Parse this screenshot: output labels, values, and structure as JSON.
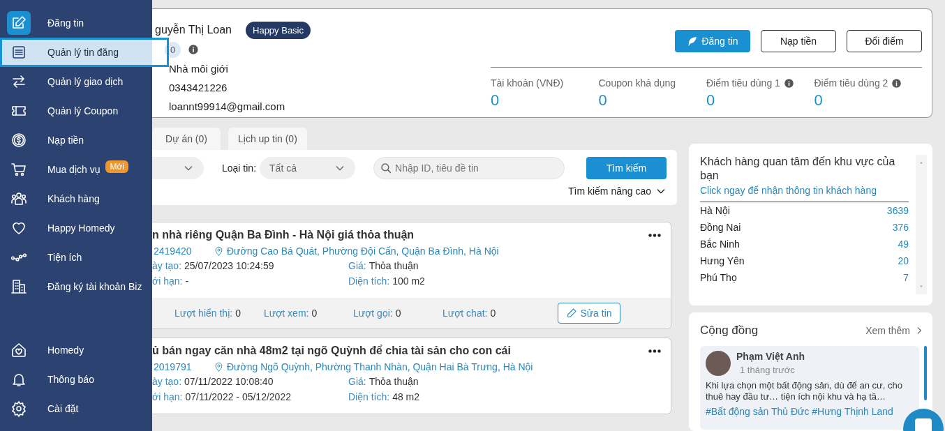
{
  "sidebar": {
    "items": [
      {
        "label": "Đăng tin",
        "selected": false,
        "icon_highlight": true
      },
      {
        "label": "Quản lý tin đăng",
        "selected": true,
        "icon_highlight": false
      },
      {
        "label": "Quản lý giao dịch",
        "selected": false,
        "icon_highlight": false
      },
      {
        "label": "Quản lý Coupon",
        "selected": false,
        "icon_highlight": false
      },
      {
        "label": "Nạp tiền",
        "selected": false,
        "icon_highlight": false
      },
      {
        "label": "Mua dịch vụ",
        "selected": false,
        "icon_highlight": false,
        "badge": "Mới"
      },
      {
        "label": "Khách hàng",
        "selected": false,
        "icon_highlight": false
      },
      {
        "label": "Happy Homedy",
        "selected": false,
        "icon_highlight": false
      },
      {
        "label": "Tiện ích",
        "selected": false,
        "icon_highlight": false
      },
      {
        "label": "Đăng ký tài khoản Biz",
        "selected": false,
        "icon_highlight": false
      }
    ],
    "bottom_items": [
      {
        "label": "Homedy",
        "selected": false
      },
      {
        "label": "Thông báo",
        "selected": false
      },
      {
        "label": "Cài đặt",
        "selected": false
      }
    ]
  },
  "profile": {
    "name": "guyễn Thị Loan",
    "badge": "Happy Basic",
    "points": "0",
    "role": "Nhà môi giới",
    "phone": "0343421226",
    "email": "loannt99914@gmail.com",
    "buttons": [
      {
        "label": "Đăng tin",
        "kind": "primary"
      },
      {
        "label": "Nạp tiền",
        "kind": "outline"
      },
      {
        "label": "Đổi điểm",
        "kind": "outline"
      }
    ],
    "stats": [
      {
        "label": "Tài khoản (VNĐ)",
        "value": "0",
        "info": false
      },
      {
        "label": "Coupon khả dụng",
        "value": "0",
        "info": false
      },
      {
        "label": "Điểm tiêu dùng 1",
        "value": "0",
        "info": true
      },
      {
        "label": "Điểm tiêu dùng 2",
        "value": "0",
        "info": true
      }
    ]
  },
  "tabs": [
    {
      "label": "Dự án (0)"
    },
    {
      "label": "Lịch up tin (0)"
    }
  ],
  "filters": {
    "type_label": "Loại tin:",
    "type_value": "Tất cả",
    "search_placeholder": "Nhập ID, tiêu đề tin",
    "search_button": "Tìm kiếm",
    "advanced": "Tìm kiếm nâng cao"
  },
  "listings": [
    {
      "title": "n nhà riêng Quận Ba Đình - Hà Nội giá thỏa thuận",
      "id": "2419420",
      "address": "Đường Cao Bá Quát, Phường Đội Cấn, Quận Ba Đình, Hà Nội",
      "created_label": "ày tạo:",
      "created": "25/07/2023 10:24:59",
      "limit_label": "ới hạn:",
      "limit": "-",
      "price_label": "Giá:",
      "price": "Thỏa thuận",
      "area_label": "Diện tích:",
      "area": "100 m2",
      "stats": [
        {
          "label": "Lượt hiển thị:",
          "value": "0"
        },
        {
          "label": "Lượt xem:",
          "value": "0"
        },
        {
          "label": "Lượt gọi:",
          "value": "0"
        },
        {
          "label": "Lượt chat:",
          "value": "0"
        }
      ],
      "edit_button": "Sửa tin"
    },
    {
      "title": "ủ bán ngay căn nhà 48m2 tại ngõ Quỳnh để chia tài sản cho con cái",
      "id": "2019791",
      "address": "Đường Ngõ Quỳnh, Phường Thanh Nhàn, Quận Hai Bà Trưng, Hà Nội",
      "created_label": "ày tạo:",
      "created": "07/11/2022 10:08:40",
      "limit_label": "ới hạn:",
      "limit": "07/11/2022 - 05/12/2022",
      "price_label": "Giá:",
      "price": "Thỏa thuận",
      "area_label": "Diện tích:",
      "area": "48 m2"
    }
  ],
  "customer_areas": {
    "title": "Khách hàng quan tâm đến khu vực của bạn",
    "link": "Click ngay để nhận thông tin khách hàng",
    "rows": [
      {
        "name": "Hà Nội",
        "count": "3639"
      },
      {
        "name": "Đồng Nai",
        "count": "376"
      },
      {
        "name": "Bắc Ninh",
        "count": "49"
      },
      {
        "name": "Hưng Yên",
        "count": "20"
      },
      {
        "name": "Phú Thọ",
        "count": "7"
      }
    ]
  },
  "community": {
    "title": "Cộng đồng",
    "more": "Xem thêm",
    "post": {
      "author": "Phạm Việt Anh",
      "time": "1 tháng trước",
      "text": "Khi lựa chọn một bất động sản, dù để an cư, cho thuê hay đầu tư… tiện ích nội khu và hạ tầ…",
      "tags": "#Bất động sản Thủ Đức #Hưng Thịnh Land"
    }
  }
}
